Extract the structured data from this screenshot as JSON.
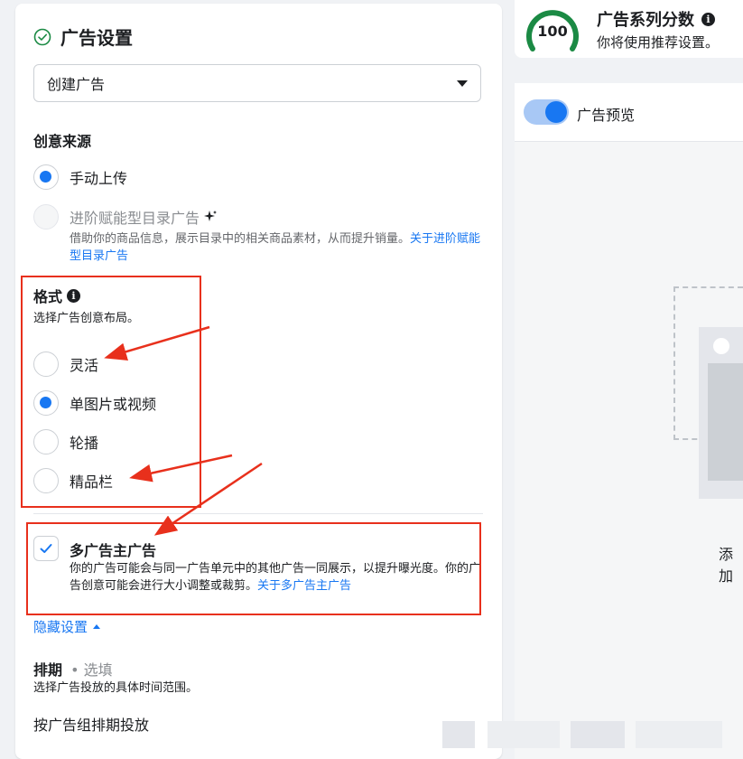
{
  "ad_settings": {
    "title": "广告设置",
    "dropdown_value": "创建广告",
    "creative_source": {
      "label": "创意来源",
      "options": [
        {
          "label": "手动上传",
          "selected": true,
          "disabled": false
        },
        {
          "label": "进阶赋能型目录广告",
          "selected": false,
          "disabled": true
        }
      ],
      "catalog_desc": "借助你的商品信息，展示目录中的相关商品素材，从而提升销量。",
      "catalog_link": "关于进阶赋能型目录广告"
    },
    "format": {
      "label": "格式",
      "desc": "选择广告创意布局。",
      "options": [
        {
          "label": "灵活",
          "selected": false
        },
        {
          "label": "单图片或视频",
          "selected": true
        },
        {
          "label": "轮播",
          "selected": false
        },
        {
          "label": "精品栏",
          "selected": false
        }
      ]
    },
    "multi_advertiser": {
      "checked": true,
      "label": "多广告主广告",
      "desc": "你的广告可能会与同一广告单元中的其他广告一同展示，以提升曝光度。你的广告创意可能会进行大小调整或裁剪。",
      "link": "关于多广告主广告"
    },
    "hide_settings_link": "隐藏设置",
    "schedule": {
      "label": "排期",
      "optional": "• 选填",
      "desc": "选择广告投放的具体时间范围。",
      "option": "按广告组排期投放"
    }
  },
  "score": {
    "value": "100",
    "title": "广告系列分数",
    "subtitle": "你将使用推荐设置。"
  },
  "preview": {
    "toggle_label": "广告预览",
    "add_text": "添加"
  },
  "colors": {
    "accent": "#1877f2",
    "annotation_red": "#e8301c",
    "score_green": "#1b8a44"
  }
}
